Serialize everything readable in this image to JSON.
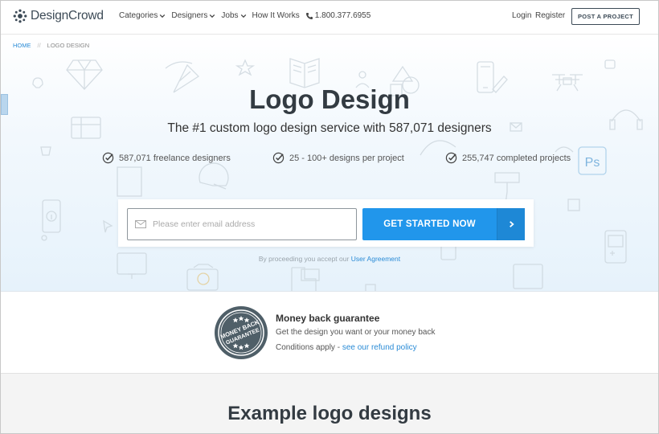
{
  "brand": {
    "name": "DesignCrowd"
  },
  "nav": {
    "items": [
      {
        "label": "Categories",
        "dropdown": true
      },
      {
        "label": "Designers",
        "dropdown": true
      },
      {
        "label": "Jobs",
        "dropdown": true
      },
      {
        "label": "How It Works",
        "dropdown": false
      }
    ],
    "phone": "1.800.377.6955",
    "login": "Login",
    "register": "Register",
    "post_project": "POST A PROJECT"
  },
  "breadcrumb": {
    "home": "HOME",
    "separator": "//",
    "current": "LOGO DESIGN"
  },
  "hero": {
    "title": "Logo Design",
    "subtitle": "The #1 custom logo design service with 587,071 designers",
    "features": [
      "587,071 freelance designers",
      "25 - 100+ designs per project",
      "255,747 completed projects"
    ],
    "email_placeholder": "Please enter email address",
    "cta_label": "GET STARTED NOW",
    "agreement_prefix": "By proceeding you accept our",
    "agreement_link": "User Agreement"
  },
  "guarantee": {
    "badge_text_1": "MONEY BACK",
    "badge_text_2": "GUARANTEE",
    "title": "Money back guarantee",
    "line1": "Get the design you want or your money back",
    "line2_prefix": "Conditions apply -",
    "line2_link": "see our refund policy"
  },
  "examples": {
    "title": "Example logo designs"
  },
  "colors": {
    "accent": "#2196eb",
    "link": "#2a8bd6",
    "dark": "#333b42",
    "badge": "#4f5f68"
  }
}
